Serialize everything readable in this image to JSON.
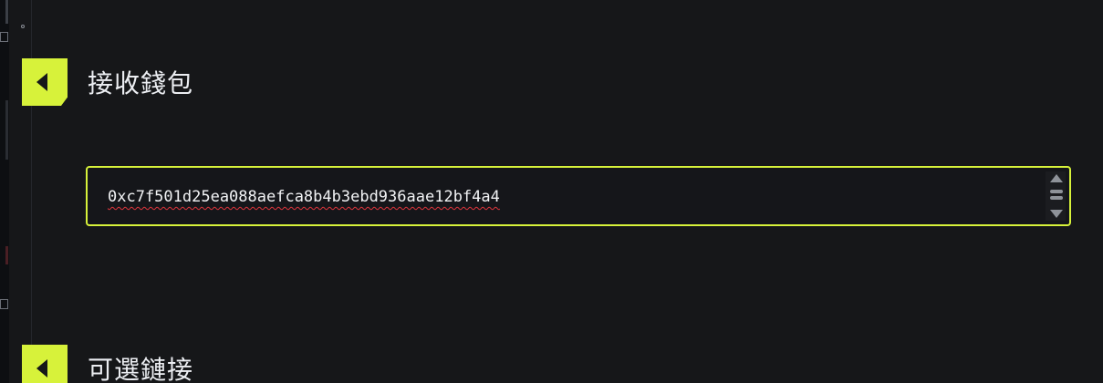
{
  "colors": {
    "background": "#161719",
    "accent": "#d7f23a",
    "text": "#eceef2",
    "spellcheck_underline": "#e0353c"
  },
  "sections": [
    {
      "title": "接收錢包",
      "icon": "chevron-left-icon"
    },
    {
      "title": "可選鏈接",
      "icon": "chevron-left-icon"
    }
  ],
  "receive_wallet": {
    "address": "0xc7f501d25ea088aefca8b4b3ebd936aae12bf4a4"
  },
  "icons": {
    "scroll_up": "triangle-up-icon",
    "scroll_thumb": "drag-handle-icon",
    "scroll_down": "triangle-down-icon"
  }
}
